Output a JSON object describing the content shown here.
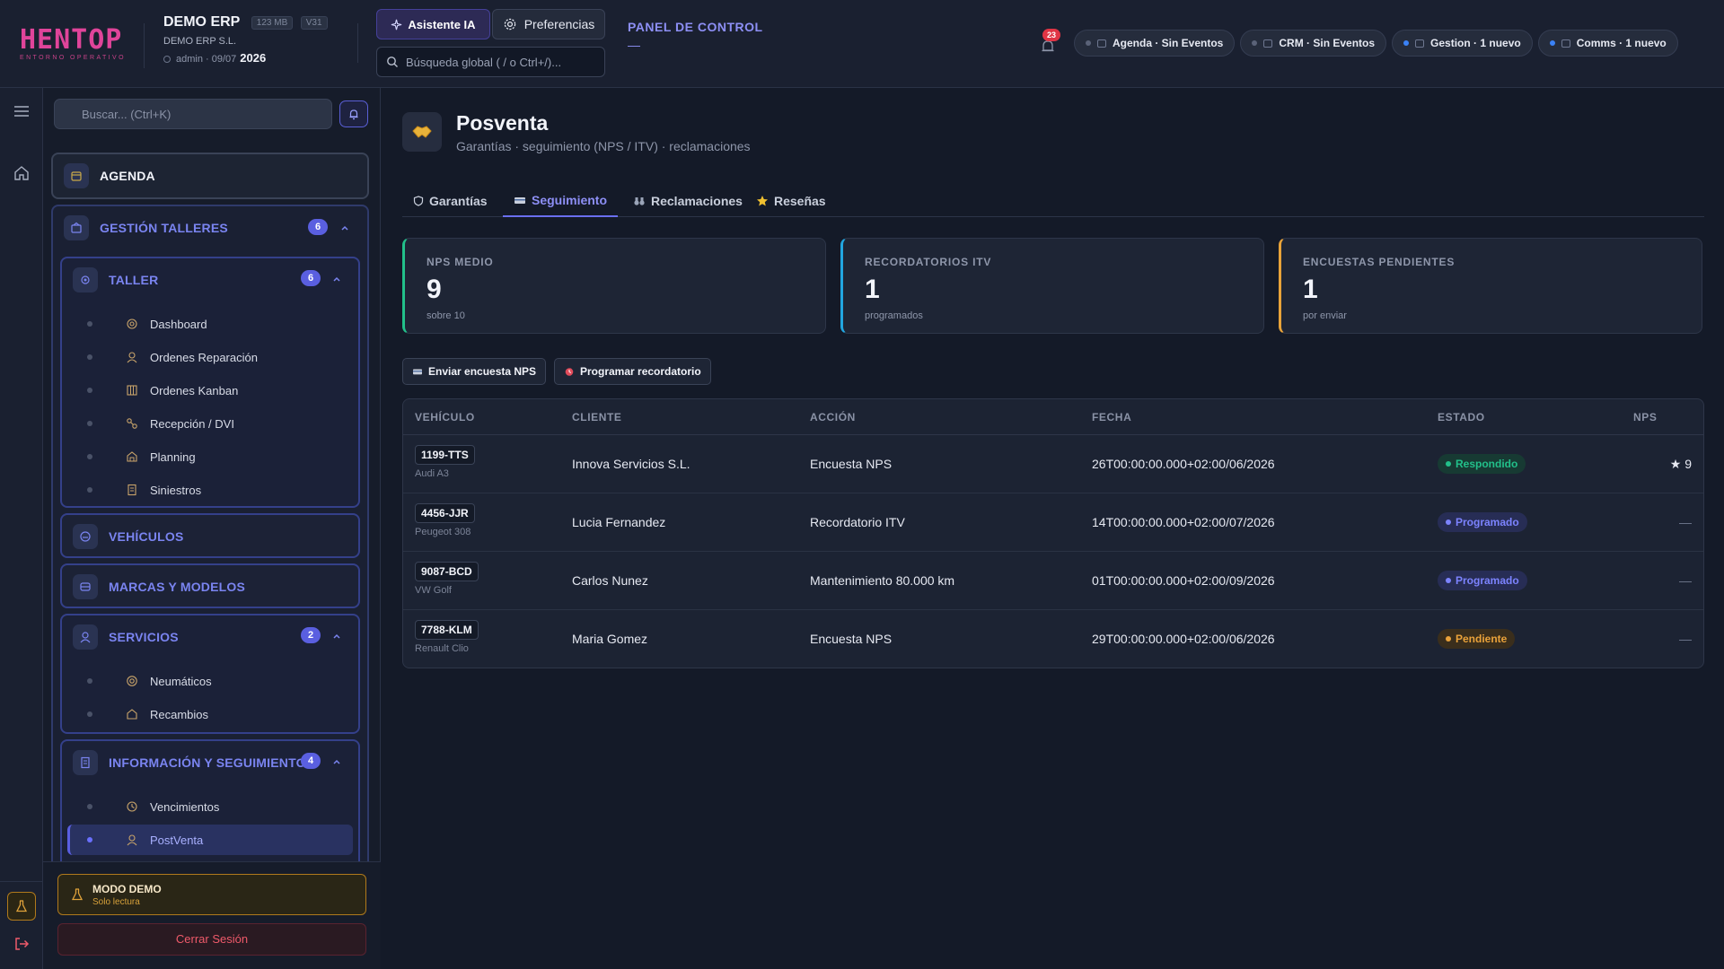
{
  "header": {
    "logo_text": "HENTOP",
    "logo_sub": "ENTORNO OPERATIVO",
    "company_name": "DEMO ERP",
    "mem_badge": "123 MB",
    "ver_badge": "V31",
    "company_legal": "DEMO ERP S.L.",
    "user": "admin",
    "date": "09/07",
    "year": "2026",
    "ai_button": "Asistente IA",
    "prefs_button": "Preferencias",
    "search_placeholder": "Búsqueda global ( / o Ctrl+/)...",
    "panel_title": "PANEL DE CONTROL",
    "panel_sub": "—",
    "notif_count": "23",
    "status_pills": [
      {
        "label": "Agenda · Sin Eventos",
        "dot_color": "#5a6278"
      },
      {
        "label": "CRM · Sin Eventos",
        "dot_color": "#5a6278"
      },
      {
        "label": "Gestion · 1 nuevo",
        "dot_color": "#3b82f6"
      },
      {
        "label": "Comms · 1 nuevo",
        "dot_color": "#3b82f6"
      }
    ]
  },
  "sidebar": {
    "search_placeholder": "Buscar... (Ctrl+K)",
    "agenda": "AGENDA",
    "gestion": {
      "label": "GESTIÓN TALLERES",
      "badge": "6"
    },
    "taller": {
      "label": "TALLER",
      "badge": "6",
      "items": [
        "Dashboard",
        "Ordenes Reparación",
        "Ordenes Kanban",
        "Recepción / DVI",
        "Planning",
        "Siniestros"
      ]
    },
    "vehiculos": "VEHÍCULOS",
    "marcas": "MARCAS Y MODELOS",
    "servicios": {
      "label": "SERVICIOS",
      "badge": "2",
      "items": [
        "Neumáticos",
        "Recambios"
      ]
    },
    "info": {
      "label": "INFORMACIÓN Y SEGUIMIENTO",
      "badge": "4",
      "items": [
        "Vencimientos",
        "PostVenta"
      ]
    },
    "demo_title": "MODO DEMO",
    "demo_sub": "Solo lectura",
    "logout": "Cerrar Sesión"
  },
  "main": {
    "title": "Posventa",
    "subtitle": "Garantías · seguimiento (NPS / ITV) · reclamaciones",
    "tabs": [
      {
        "label": "Garantías",
        "icon": "shield-icon"
      },
      {
        "label": "Seguimiento",
        "icon": "card-icon"
      },
      {
        "label": "Reclamaciones",
        "icon": "binoculars-icon"
      },
      {
        "label": "Reseñas",
        "icon": "star-icon"
      }
    ],
    "kpis": [
      {
        "label": "NPS MEDIO",
        "value": "9",
        "sub": "sobre 10",
        "accent": "#22c08a"
      },
      {
        "label": "RECORDATORIOS ITV",
        "value": "1",
        "sub": "programados",
        "accent": "#22a6e0"
      },
      {
        "label": "ENCUESTAS PENDIENTES",
        "value": "1",
        "sub": "por enviar",
        "accent": "#e8a33a"
      }
    ],
    "actions": {
      "send": "Enviar encuesta NPS",
      "schedule": "Programar recordatorio"
    },
    "table": {
      "headers": [
        "VEHÍCULO",
        "CLIENTE",
        "ACCIÓN",
        "FECHA",
        "ESTADO",
        "NPS"
      ],
      "rows": [
        {
          "plate": "1199-TTS",
          "model": "Audi A3",
          "client": "Innova Servicios S.L.",
          "action": "Encuesta NPS",
          "date": "26T00:00:00.000+02:00/06/2026",
          "status": "Respondido",
          "status_color": "#22c08a",
          "status_bg": "#173a33",
          "nps": "★ 9"
        },
        {
          "plate": "4456-JJR",
          "model": "Peugeot 308",
          "client": "Lucia Fernandez",
          "action": "Recordatorio ITV",
          "date": "14T00:00:00.000+02:00/07/2026",
          "status": "Programado",
          "status_color": "#7c83ff",
          "status_bg": "#272d55",
          "nps": "—"
        },
        {
          "plate": "9087-BCD",
          "model": "VW Golf",
          "client": "Carlos Nunez",
          "action": "Mantenimiento 80.000 km",
          "date": "01T00:00:00.000+02:00/09/2026",
          "status": "Programado",
          "status_color": "#7c83ff",
          "status_bg": "#272d55",
          "nps": "—"
        },
        {
          "plate": "7788-KLM",
          "model": "Renault Clio",
          "client": "Maria Gomez",
          "action": "Encuesta NPS",
          "date": "29T00:00:00.000+02:00/06/2026",
          "status": "Pendiente",
          "status_color": "#eaa23a",
          "status_bg": "#3a2e1c",
          "nps": "—"
        }
      ]
    }
  }
}
